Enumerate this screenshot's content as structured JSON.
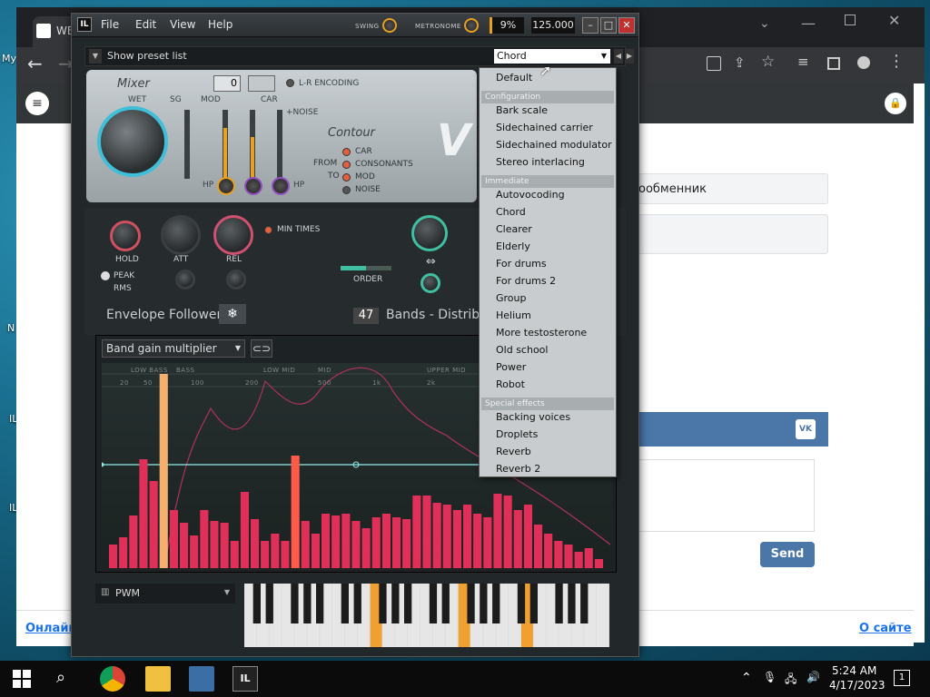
{
  "desktop": {
    "icons": [
      "My",
      "N",
      "IL",
      "IL"
    ]
  },
  "browser": {
    "tab_title": "WE",
    "site": {
      "card1_text": "ообменник",
      "send_label": "Send",
      "vk_label": "VK",
      "footer_left": "Онлайн",
      "footer_right": "О сайте"
    }
  },
  "vocoder": {
    "menu": [
      "File",
      "Edit",
      "View",
      "Help"
    ],
    "swing_label": "SWING",
    "metronome_label": "METRONOME",
    "cpu": "9%",
    "tempo": "125.000",
    "preset_bar_label": "Show preset list",
    "preset_selected": "Chord",
    "mixer": {
      "title": "Mixer",
      "wet": "WET",
      "sg": "SG",
      "mod": "MOD",
      "car": "CAR",
      "noise": "+NOISE",
      "hp1": "HP",
      "hp2": "HP",
      "box1": "0",
      "lr_encoding": "L-R ENCODING",
      "contour": "Contour",
      "from": "FROM",
      "to": "TO",
      "contour_opts": [
        "CAR",
        "CONSONANTS",
        "MOD",
        "NOISE"
      ]
    },
    "envelope": {
      "hold": "HOLD",
      "att": "ATT",
      "rel": "REL",
      "min_times": "MIN TIMES",
      "peak": "PEAK",
      "rms": "RMS",
      "order": "ORDER",
      "title": "Envelope Follower",
      "bands_count": "47",
      "bands_label": "Bands - Distributi"
    },
    "graph": {
      "selector": "Band gain multiplier",
      "regions": [
        "LOW BASS",
        "BASS",
        "LOW MID",
        "MID",
        "UPPER MID"
      ],
      "freq_ticks": [
        "20",
        "50",
        "100",
        "200",
        "500",
        "1k",
        "2k"
      ]
    },
    "pwm_label": "PWM",
    "dropdown": [
      {
        "type": "item",
        "label": "Default"
      },
      {
        "type": "section",
        "label": "Configuration"
      },
      {
        "type": "item",
        "label": "Bark scale"
      },
      {
        "type": "item",
        "label": "Sidechained carrier"
      },
      {
        "type": "item",
        "label": "Sidechained modulator"
      },
      {
        "type": "item",
        "label": "Stereo interlacing"
      },
      {
        "type": "section",
        "label": "Immediate"
      },
      {
        "type": "item",
        "label": "Autovocoding"
      },
      {
        "type": "item",
        "label": "Chord"
      },
      {
        "type": "item",
        "label": "Clearer"
      },
      {
        "type": "item",
        "label": "Elderly"
      },
      {
        "type": "item",
        "label": "For drums"
      },
      {
        "type": "item",
        "label": "For drums 2"
      },
      {
        "type": "item",
        "label": "Group"
      },
      {
        "type": "item",
        "label": "Helium"
      },
      {
        "type": "item",
        "label": "More testosterone"
      },
      {
        "type": "item",
        "label": "Old school"
      },
      {
        "type": "item",
        "label": "Power"
      },
      {
        "type": "item",
        "label": "Robot"
      },
      {
        "type": "section",
        "label": "Special effects"
      },
      {
        "type": "item",
        "label": "Backing voices"
      },
      {
        "type": "item",
        "label": "Droplets"
      },
      {
        "type": "item",
        "label": "Reverb"
      },
      {
        "type": "item",
        "label": "Reverb 2"
      }
    ]
  },
  "taskbar": {
    "time": "5:24 AM",
    "date": "4/17/2023",
    "notif_count": "1"
  }
}
